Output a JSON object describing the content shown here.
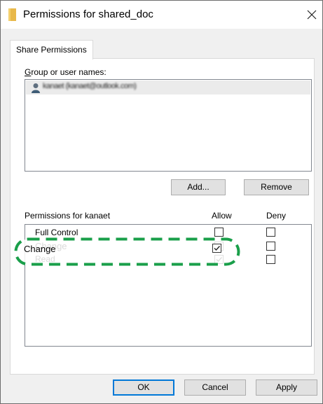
{
  "window": {
    "title": "Permissions for shared_doc",
    "close_glyph": "✕",
    "title_icon": "folder-icon"
  },
  "tab": {
    "label": "Share Permissions"
  },
  "group_section": {
    "label": "Group or user names:",
    "users": [
      {
        "name": "kanaet (kanaet@outlook.com)",
        "icon": "user-icon"
      }
    ]
  },
  "buttons": {
    "add": "Add...",
    "remove": "Remove",
    "ok": "OK",
    "cancel": "Cancel",
    "apply": "Apply"
  },
  "permissions": {
    "header": "Permissions for kanaet",
    "allow_label": "Allow",
    "deny_label": "Deny",
    "rows": [
      {
        "name": "Full Control",
        "allow": false,
        "deny": false
      },
      {
        "name": "Change",
        "allow": true,
        "deny": false
      },
      {
        "name": "Read",
        "allow": true,
        "deny": false
      }
    ]
  },
  "colors": {
    "highlight_green": "#1a9f4a",
    "accent_blue": "#0078d7",
    "selection_gray": "#ebebeb"
  }
}
